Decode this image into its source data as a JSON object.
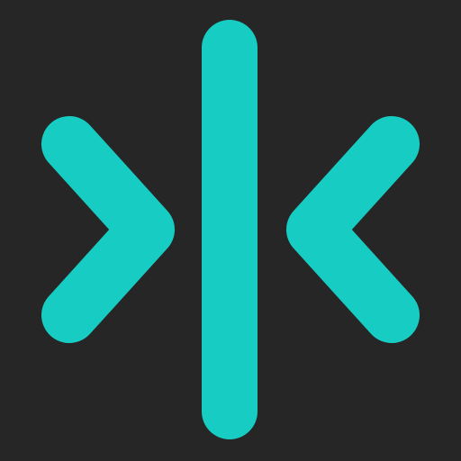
{
  "icon": {
    "name": "collapse-horizontal-icon",
    "background_color": "#262626",
    "accent_color": "#17CDC3"
  }
}
